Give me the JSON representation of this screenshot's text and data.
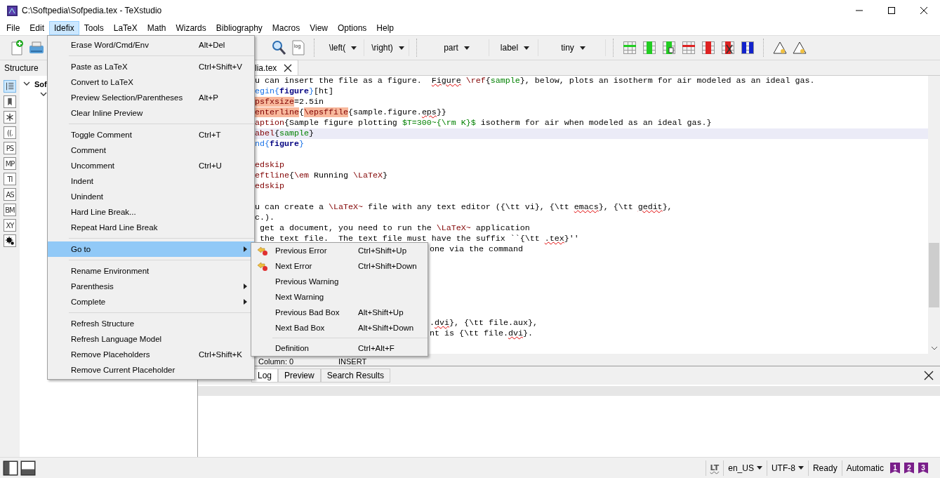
{
  "window": {
    "title": "C:\\Softpedia\\Sofpedia.tex - TeXstudio"
  },
  "menubar": [
    {
      "label": "File",
      "selected": false
    },
    {
      "label": "Edit",
      "selected": false
    },
    {
      "label": "Idefix",
      "selected": true
    },
    {
      "label": "Tools",
      "selected": false
    },
    {
      "label": "LaTeX",
      "selected": false
    },
    {
      "label": "Math",
      "selected": false
    },
    {
      "label": "Wizards",
      "selected": false
    },
    {
      "label": "Bibliography",
      "selected": false
    },
    {
      "label": "Macros",
      "selected": false
    },
    {
      "label": "View",
      "selected": false
    },
    {
      "label": "Options",
      "selected": false
    },
    {
      "label": "Help",
      "selected": false
    }
  ],
  "toolbar": {
    "log_label": "log",
    "dropdowns": [
      {
        "value": "\\left(",
        "kind": "narrow"
      },
      {
        "value": "\\right)",
        "kind": "narrow"
      },
      {
        "value": "part",
        "kind": "wide"
      },
      {
        "value": "label",
        "kind": "medium"
      },
      {
        "value": "tiny",
        "kind": "wide"
      }
    ]
  },
  "structure": {
    "title": "Structure",
    "tree": [
      {
        "label": "Sof",
        "expanded": true,
        "children": [
          {
            "expanded": true
          }
        ]
      }
    ]
  },
  "sidebar_tabs": [
    {
      "kind": "list",
      "selected": true
    },
    {
      "kind": "bookmark",
      "selected": false
    },
    {
      "kind": "asterisk",
      "selected": false
    },
    {
      "kind": "label",
      "label": "((.",
      "selected": false
    },
    {
      "kind": "label",
      "label": "PS",
      "selected": false
    },
    {
      "kind": "label",
      "label": "MP",
      "selected": false
    },
    {
      "kind": "label",
      "label": "TI",
      "selected": false
    },
    {
      "kind": "label",
      "label": "AS",
      "selected": false
    },
    {
      "kind": "label",
      "label": "BM",
      "selected": false
    },
    {
      "kind": "label",
      "label": "XY",
      "selected": false
    },
    {
      "kind": "splat",
      "selected": false
    }
  ],
  "editor": {
    "tabs": [
      {
        "label": "lia.tex",
        "selected": true
      }
    ],
    "lines": [
      {
        "kind": "full",
        "current": false,
        "segments": [
          {
            "kind": "plain",
            "t": "u can insert the file as a figure.  "
          },
          {
            "kind": "spell",
            "t": "Figure"
          },
          {
            "kind": "cmd",
            "t": " \\ref"
          },
          {
            "kind": "plain",
            "t": "{"
          },
          {
            "kind": "arg",
            "t": "sample"
          },
          {
            "kind": "plain",
            "t": "}, below, plots an isotherm for air modeled as an ideal gas."
          }
        ]
      },
      {
        "kind": "full",
        "current": false,
        "segments": [
          {
            "kind": "envcmd",
            "t": "egin{"
          },
          {
            "kind": "env",
            "t": "figure"
          },
          {
            "kind": "envcmd",
            "t": "}"
          },
          {
            "kind": "plain",
            "t": "[ht]"
          }
        ]
      },
      {
        "kind": "full",
        "current": false,
        "segments": [
          {
            "kind": "hl",
            "t": "psfxsize"
          },
          {
            "kind": "plain",
            "t": "=2.5in"
          }
        ]
      },
      {
        "kind": "full",
        "current": false,
        "segments": [
          {
            "kind": "hl",
            "t": "enterline"
          },
          {
            "kind": "plain",
            "t": "{"
          },
          {
            "kind": "hl",
            "t": "\\epsffile"
          },
          {
            "kind": "plain",
            "t": "{sample.figure."
          },
          {
            "kind": "spell",
            "t": "eps"
          },
          {
            "kind": "plain",
            "t": "}}"
          }
        ]
      },
      {
        "kind": "full",
        "current": false,
        "segments": [
          {
            "kind": "cmd",
            "t": "aption"
          },
          {
            "kind": "plain",
            "t": "{Sample figure plotting "
          },
          {
            "kind": "math",
            "t": "$T=300~{\\rm K}$"
          },
          {
            "kind": "plain",
            "t": " isotherm for air when modeled as an ideal gas.}"
          }
        ]
      },
      {
        "kind": "full",
        "current": true,
        "segments": [
          {
            "kind": "cmd",
            "t": "abel"
          },
          {
            "kind": "plain",
            "t": "{"
          },
          {
            "kind": "arg",
            "t": "sample"
          },
          {
            "kind": "plain",
            "t": "}"
          }
        ]
      },
      {
        "kind": "full",
        "current": false,
        "segments": [
          {
            "kind": "envcmd",
            "t": "nd{"
          },
          {
            "kind": "env",
            "t": "figure"
          },
          {
            "kind": "envcmd",
            "t": "}"
          }
        ]
      },
      {
        "kind": "blank",
        "current": false
      },
      {
        "kind": "full",
        "current": false,
        "segments": [
          {
            "kind": "cmd",
            "t": "edskip"
          }
        ]
      },
      {
        "kind": "full",
        "current": false,
        "segments": [
          {
            "kind": "cmd",
            "t": "eftline"
          },
          {
            "kind": "plain",
            "t": "{"
          },
          {
            "kind": "cmd",
            "t": "\\em"
          },
          {
            "kind": "plain",
            "t": " Running "
          },
          {
            "kind": "cmd",
            "t": "\\LaTeX"
          },
          {
            "kind": "plain",
            "t": "}"
          }
        ]
      },
      {
        "kind": "full",
        "current": false,
        "segments": [
          {
            "kind": "cmd",
            "t": "edskip"
          }
        ]
      },
      {
        "kind": "blank",
        "current": false
      },
      {
        "kind": "full",
        "current": false,
        "segments": [
          {
            "kind": "plain",
            "t": "u can create a "
          },
          {
            "kind": "cmd",
            "t": "\\LaTeX~"
          },
          {
            "kind": "plain",
            "t": " file with any text editor ({\\tt vi}, {\\tt "
          },
          {
            "kind": "spell",
            "t": "emacs"
          },
          {
            "kind": "plain",
            "t": "}, {\\tt "
          },
          {
            "kind": "spell",
            "t": "gedit"
          },
          {
            "kind": "plain",
            "t": "},"
          }
        ]
      },
      {
        "kind": "full",
        "current": false,
        "segments": [
          {
            "kind": "plain",
            "t": "c.)."
          }
        ]
      },
      {
        "kind": "full",
        "current": false,
        "segments": [
          {
            "kind": "plain",
            "t": " get a document, you need to run the "
          },
          {
            "kind": "cmd",
            "t": "\\LaTeX~"
          },
          {
            "kind": "plain",
            "t": " application"
          }
        ]
      },
      {
        "kind": "full",
        "current": false,
        "segments": [
          {
            "kind": "plain",
            "t": " the text file.  The text file must have the suffix ``{\\tt "
          },
          {
            "kind": "spell",
            "t": ".tex"
          },
          {
            "kind": "plain",
            "t": "}''"
          }
        ]
      },
      {
        "kind": "partial",
        "current": false,
        "segments": [
          {
            "kind": "plain",
            "t": "one via the command"
          }
        ]
      },
      {
        "kind": "blank",
        "current": false
      },
      {
        "kind": "blank",
        "current": false
      },
      {
        "kind": "blank",
        "current": false
      },
      {
        "kind": "blank",
        "current": false
      },
      {
        "kind": "blank",
        "current": false
      },
      {
        "kind": "blank",
        "current": false
      },
      {
        "kind": "partial",
        "current": false,
        "segments": [
          {
            "kind": "plain",
            "t": "."
          },
          {
            "kind": "spell",
            "t": "dvi"
          },
          {
            "kind": "plain",
            "t": "}, {\\tt file.aux},"
          }
        ]
      },
      {
        "kind": "partial",
        "current": false,
        "segments": [
          {
            "kind": "plain",
            "t": "nt is {\\tt file."
          },
          {
            "kind": "spell",
            "t": "dvi"
          },
          {
            "kind": "plain",
            "t": "}."
          }
        ]
      }
    ]
  },
  "editor_status": {
    "column": "Column: 0",
    "mode": "INSERT"
  },
  "bottom_panel": {
    "tabs": [
      {
        "label": "Log",
        "selected": true
      },
      {
        "label": "Preview",
        "selected": false
      },
      {
        "label": "Search Results",
        "selected": false
      }
    ]
  },
  "status_bar": {
    "lt": "LT",
    "language": "en_US",
    "encoding": "UTF-8",
    "state": "Ready",
    "mode": "Automatic",
    "bookmarks": [
      "1",
      "2",
      "3"
    ]
  },
  "idefix_menu": {
    "items": [
      {
        "kind": "item",
        "label": "Erase Word/Cmd/Env",
        "shortcut": "Alt+Del",
        "submenu": false,
        "selected": false
      },
      {
        "kind": "separator"
      },
      {
        "kind": "item",
        "label": "Paste as LaTeX",
        "shortcut": "Ctrl+Shift+V",
        "submenu": false,
        "selected": false
      },
      {
        "kind": "item",
        "label": "Convert to LaTeX",
        "submenu": false,
        "selected": false
      },
      {
        "kind": "item",
        "label": "Preview Selection/Parentheses",
        "shortcut": "Alt+P",
        "submenu": false,
        "selected": false
      },
      {
        "kind": "item",
        "label": "Clear Inline Preview",
        "submenu": false,
        "selected": false
      },
      {
        "kind": "separator"
      },
      {
        "kind": "item",
        "label": "Toggle Comment",
        "shortcut": "Ctrl+T",
        "submenu": false,
        "selected": false
      },
      {
        "kind": "item",
        "label": "Comment",
        "submenu": false,
        "selected": false
      },
      {
        "kind": "item",
        "label": "Uncomment",
        "shortcut": "Ctrl+U",
        "submenu": false,
        "selected": false
      },
      {
        "kind": "item",
        "label": "Indent",
        "submenu": false,
        "selected": false
      },
      {
        "kind": "item",
        "label": "Unindent",
        "submenu": false,
        "selected": false
      },
      {
        "kind": "item",
        "label": "Hard Line Break...",
        "submenu": false,
        "selected": false
      },
      {
        "kind": "item",
        "label": "Repeat Hard Line Break",
        "submenu": false,
        "selected": false
      },
      {
        "kind": "separator"
      },
      {
        "kind": "item",
        "label": "Go to",
        "submenu": true,
        "selected": true
      },
      {
        "kind": "separator"
      },
      {
        "kind": "item",
        "label": "Rename Environment",
        "submenu": false,
        "selected": false
      },
      {
        "kind": "item",
        "label": "Parenthesis",
        "submenu": true,
        "selected": false
      },
      {
        "kind": "item",
        "label": "Complete",
        "submenu": true,
        "selected": false
      },
      {
        "kind": "separator"
      },
      {
        "kind": "item",
        "label": "Refresh Structure",
        "submenu": false,
        "selected": false
      },
      {
        "kind": "item",
        "label": "Refresh Language Model",
        "submenu": false,
        "selected": false
      },
      {
        "kind": "item",
        "label": "Remove Placeholders",
        "shortcut": "Ctrl+Shift+K",
        "submenu": false,
        "selected": false
      },
      {
        "kind": "item",
        "label": "Remove Current Placeholder",
        "submenu": false,
        "selected": false
      }
    ]
  },
  "goto_submenu": {
    "items": [
      {
        "kind": "icon-item",
        "label": "Previous Error",
        "shortcut": "Ctrl+Shift+Up"
      },
      {
        "kind": "icon-item",
        "label": "Next Error",
        "shortcut": "Ctrl+Shift+Down"
      },
      {
        "kind": "item",
        "label": "Previous Warning"
      },
      {
        "kind": "item",
        "label": "Next Warning"
      },
      {
        "kind": "item",
        "label": "Previous Bad Box",
        "shortcut": "Alt+Shift+Up"
      },
      {
        "kind": "item",
        "label": "Next Bad Box",
        "shortcut": "Alt+Shift+Down"
      },
      {
        "kind": "separator"
      },
      {
        "kind": "item",
        "label": "Definition",
        "shortcut": "Ctrl+Alt+F"
      }
    ]
  }
}
